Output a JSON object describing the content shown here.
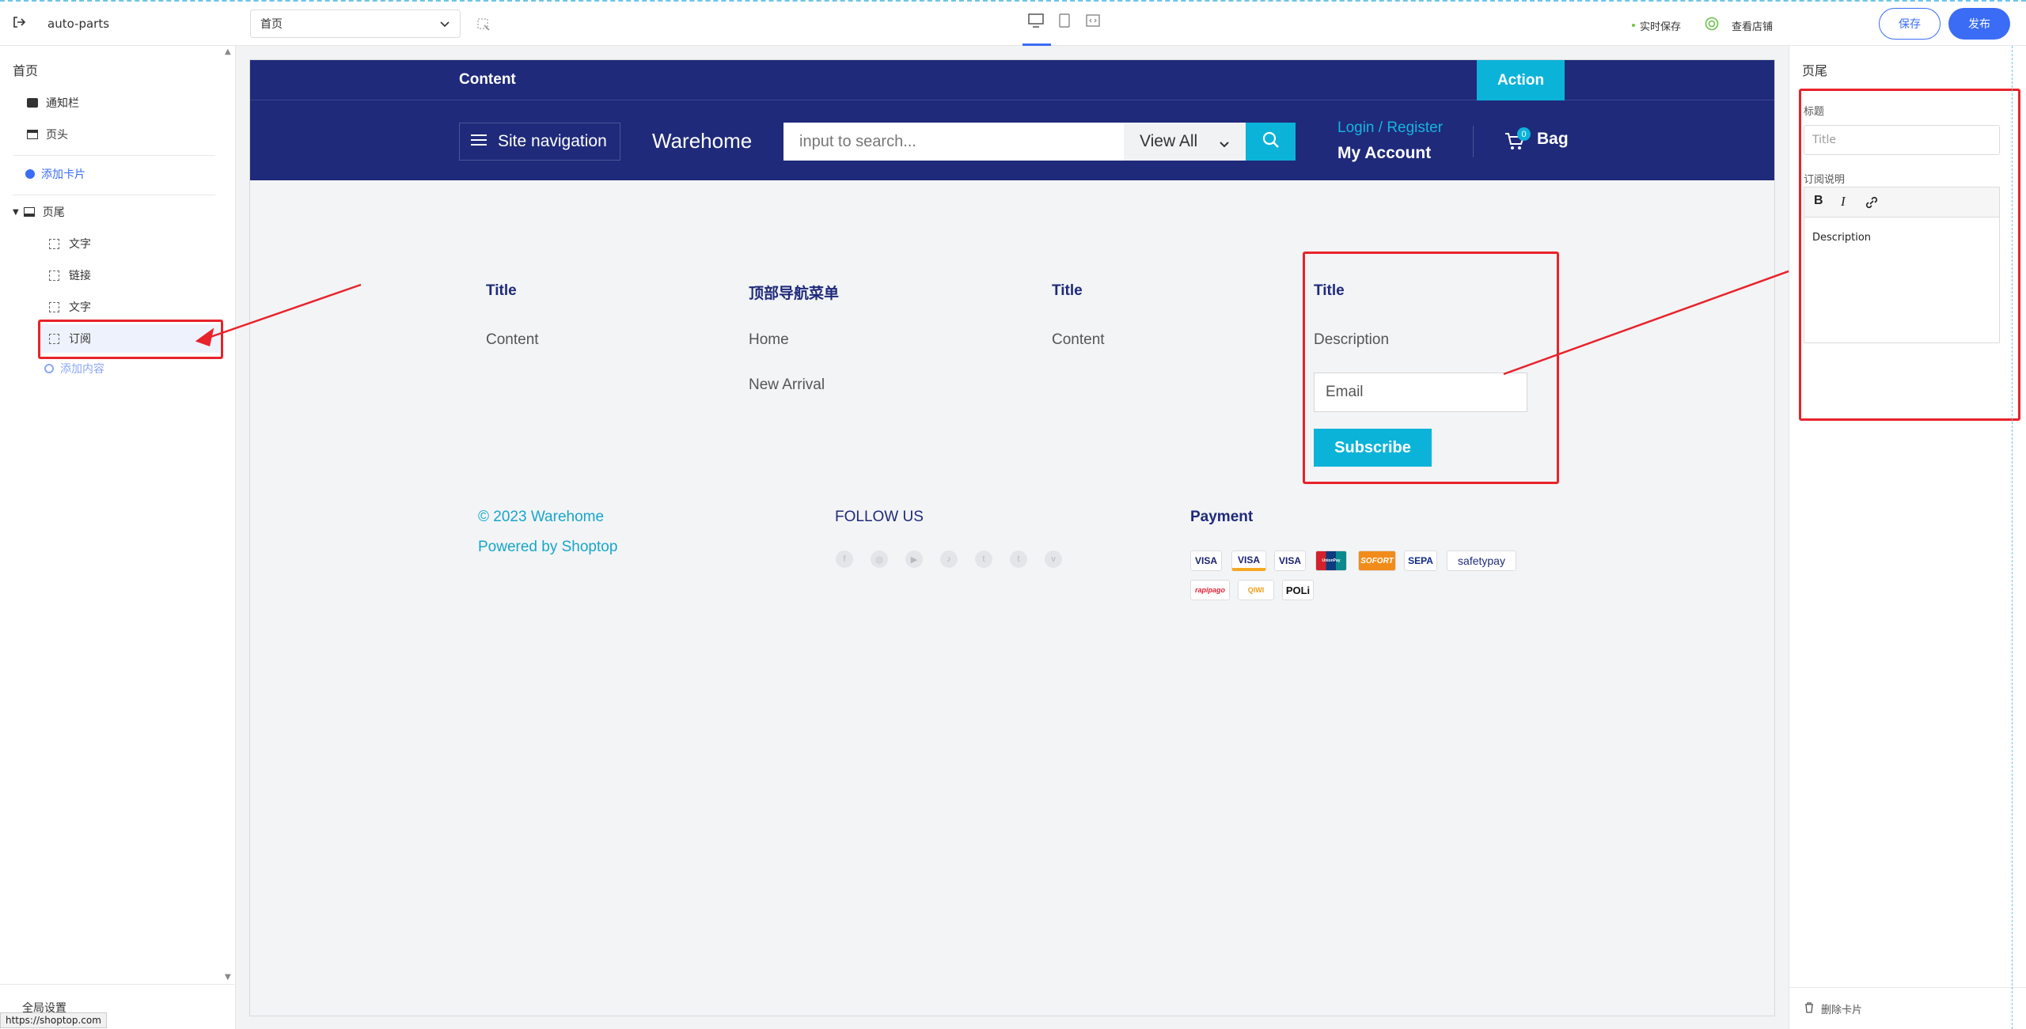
{
  "topbar": {
    "site_name": "auto-parts",
    "page_select": "首页",
    "realtime_save": "实时保存",
    "view_store": "查看店铺",
    "save_label": "保存",
    "publish_label": "发布"
  },
  "sidebar": {
    "title": "首页",
    "items": [
      {
        "label": "通知栏"
      },
      {
        "label": "页头"
      }
    ],
    "add_card": "添加卡片",
    "footer_group": "页尾",
    "children": [
      {
        "label": "文字"
      },
      {
        "label": "链接"
      },
      {
        "label": "文字"
      },
      {
        "label": "订阅"
      }
    ],
    "add_content": "添加内容",
    "global_settings": "全局设置",
    "status_url": "https://shoptop.com"
  },
  "preview": {
    "announcement": {
      "text": "Content",
      "action": "Action"
    },
    "header": {
      "nav_button": "Site navigation",
      "logo": "Warehome",
      "search_placeholder": "input to search...",
      "search_category": "View All",
      "login": "Login / Register",
      "account": "My Account",
      "cart_count": "0",
      "bag": "Bag"
    },
    "footer": {
      "col1": {
        "title": "Title",
        "content": "Content"
      },
      "col2": {
        "title": "顶部导航菜单",
        "links": [
          "Home",
          "New Arrival"
        ]
      },
      "col3": {
        "title": "Title",
        "content": "Content"
      },
      "subscribe": {
        "title": "Title",
        "description": "Description",
        "email_placeholder": "Email",
        "button": "Subscribe"
      },
      "copyright": "© 2023 Warehome",
      "powered": "Powered by Shoptop",
      "follow_title": "FOLLOW US",
      "social_icons": [
        "facebook-icon",
        "instagram-icon",
        "youtube-icon",
        "tiktok-icon",
        "twitter-icon",
        "tumblr-icon",
        "vimeo-icon"
      ],
      "payment_title": "Payment",
      "payment_icons": [
        "VISA",
        "VISA",
        "VISA",
        "UnionPay",
        "SOFORT",
        "SEPA",
        "safetypay",
        "rapipago",
        "QIWI",
        "POLi"
      ]
    }
  },
  "panel": {
    "title": "页尾",
    "field_title_label": "标题",
    "field_title_placeholder": "Title",
    "field_desc_label": "订阅说明",
    "desc_value": "Description",
    "delete_card": "删除卡片"
  },
  "colors": {
    "accent": "#1f2a7a",
    "teal": "#0cb3d9",
    "primary": "#3b6cf6",
    "annotation": "#e8232b"
  }
}
